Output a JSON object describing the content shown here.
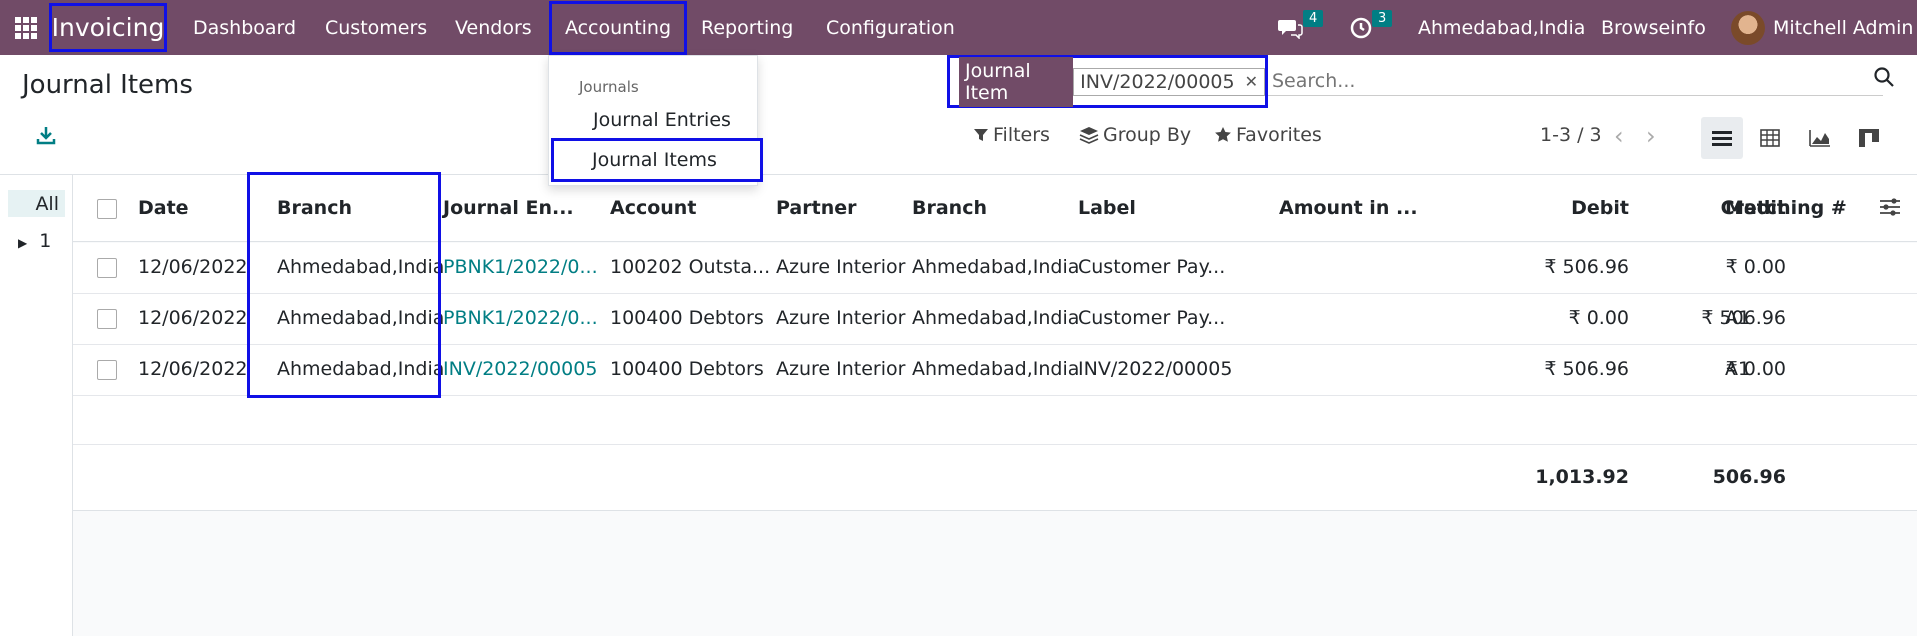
{
  "navbar": {
    "brand": "Invoicing",
    "menu": [
      "Dashboard",
      "Customers",
      "Vendors",
      "Accounting",
      "Reporting",
      "Configuration"
    ],
    "messages_count": "4",
    "activities_count": "3",
    "branch": "Ahmedabad,India",
    "company": "Browseinfo",
    "user": "Mitchell Admin"
  },
  "dropdown": {
    "header": "Journals",
    "items": [
      "Journal Entries",
      "Journal Items"
    ]
  },
  "page": {
    "title": "Journal Items"
  },
  "search": {
    "facet_label": "Journal Item",
    "facet_value": "INV/2022/00005",
    "placeholder": "Search..."
  },
  "controls": {
    "filters": "Filters",
    "group_by": "Group By",
    "favorites": "Favorites",
    "pager": "1-3 / 3"
  },
  "sidepanel": {
    "all": "All",
    "item": "1"
  },
  "table": {
    "headers": [
      "Date",
      "Branch",
      "Journal En...",
      "Account",
      "Partner",
      "Branch",
      "Label",
      "Amount in ...",
      "Debit",
      "Credit",
      "Matching #"
    ],
    "rows": [
      {
        "date": "12/06/2022",
        "branch": "Ahmedabad,India",
        "journal_entry": "PBNK1/2022/0...",
        "account": "100202 Outsta...",
        "partner": "Azure Interior",
        "branch2": "Ahmedabad,India",
        "label": "Customer Pay...",
        "amount": "",
        "debit": "₹ 506.96",
        "credit": "₹ 0.00",
        "matching": ""
      },
      {
        "date": "12/06/2022",
        "branch": "Ahmedabad,India",
        "journal_entry": "PBNK1/2022/0...",
        "account": "100400 Debtors",
        "partner": "Azure Interior",
        "branch2": "Ahmedabad,India",
        "label": "Customer Pay...",
        "amount": "",
        "debit": "₹ 0.00",
        "credit": "₹ 506.96",
        "matching": "A1"
      },
      {
        "date": "12/06/2022",
        "branch": "Ahmedabad,India",
        "journal_entry": "INV/2022/00005",
        "account": "100400 Debtors",
        "partner": "Azure Interior",
        "branch2": "Ahmedabad,India",
        "label": "INV/2022/00005",
        "amount": "",
        "debit": "₹ 506.96",
        "credit": "₹ 0.00",
        "matching": "A1"
      }
    ],
    "totals": {
      "debit": "1,013.92",
      "credit": "506.96"
    }
  },
  "colors": {
    "brand": "#714b67",
    "link": "#017e84",
    "highlight": "#1010e6"
  }
}
